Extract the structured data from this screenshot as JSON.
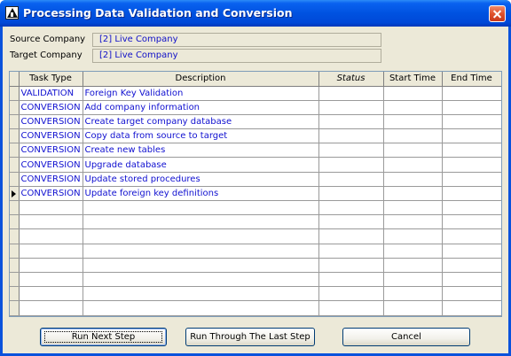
{
  "window": {
    "title": "Processing Data Validation and Conversion"
  },
  "fields": {
    "source_label": "Source Company",
    "source_value": "[2] Live Company",
    "target_label": "Target Company",
    "target_value": "[2] Live Company"
  },
  "grid": {
    "columns": [
      "Task Type",
      "Description",
      "Status",
      "Start Time",
      "End Time"
    ],
    "rows": [
      {
        "type": "VALIDATION",
        "description": "Foreign Key Validation",
        "status": "",
        "start": "",
        "end": ""
      },
      {
        "type": "CONVERSION",
        "description": "Add company information",
        "status": "",
        "start": "",
        "end": ""
      },
      {
        "type": "CONVERSION",
        "description": "Create target company database",
        "status": "",
        "start": "",
        "end": ""
      },
      {
        "type": "CONVERSION",
        "description": "Copy data from source to target",
        "status": "",
        "start": "",
        "end": ""
      },
      {
        "type": "CONVERSION",
        "description": "Create new tables",
        "status": "",
        "start": "",
        "end": ""
      },
      {
        "type": "CONVERSION",
        "description": "Upgrade database",
        "status": "",
        "start": "",
        "end": ""
      },
      {
        "type": "CONVERSION",
        "description": "Update stored procedures",
        "status": "",
        "start": "",
        "end": ""
      },
      {
        "type": "CONVERSION",
        "description": "Update foreign key definitions",
        "status": "",
        "start": "",
        "end": ""
      }
    ],
    "empty_rows": 8,
    "current_row_index": 7
  },
  "buttons": {
    "run_next": "Run Next Step",
    "run_through": "Run Through The Last Step",
    "cancel": "Cancel"
  },
  "colors": {
    "title_bar": "#0054e3",
    "cell_text": "#1010d0",
    "window_bg": "#ece9d8",
    "close_button": "#e0522c"
  },
  "icons": {
    "app": "app-logo-icon",
    "close": "close-icon",
    "row_pointer": "row-pointer-icon"
  }
}
